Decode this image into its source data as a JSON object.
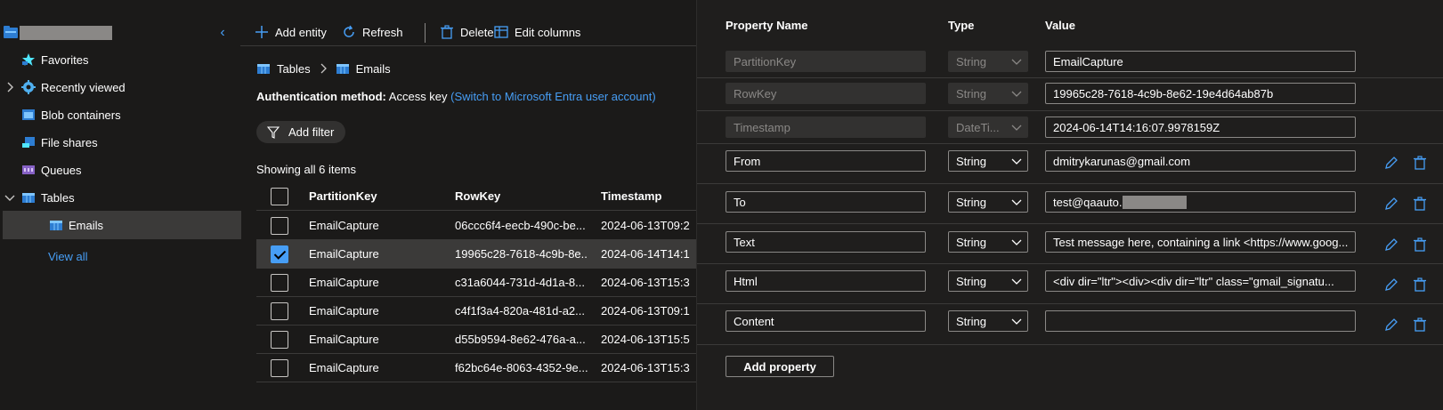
{
  "sidebar": {
    "items": [
      {
        "label": "Favorites",
        "icon": "star-icon"
      },
      {
        "label": "Recently viewed",
        "icon": "gear-icon"
      },
      {
        "label": "Blob containers",
        "icon": "blob-container-icon"
      },
      {
        "label": "File shares",
        "icon": "file-share-icon"
      },
      {
        "label": "Queues",
        "icon": "queue-icon"
      },
      {
        "label": "Tables",
        "icon": "table-icon"
      },
      {
        "label": "Emails",
        "icon": "table-icon"
      }
    ],
    "view_all": "View all"
  },
  "toolbar": {
    "add_entity": "Add entity",
    "refresh": "Refresh",
    "delete": "Delete",
    "edit_columns": "Edit columns"
  },
  "breadcrumb": {
    "root": "Tables",
    "current": "Emails"
  },
  "auth": {
    "label": "Authentication method:",
    "value": "Access key",
    "link": "(Switch to Microsoft Entra user account)"
  },
  "filter": {
    "label": "Add filter"
  },
  "showing": "Showing all 6 items",
  "table": {
    "headers": [
      "PartitionKey",
      "RowKey",
      "Timestamp"
    ],
    "rows": [
      {
        "pk": "EmailCapture",
        "rk": "06ccc6f4-eecb-490c-be...",
        "ts": "2024-06-13T09:2",
        "checked": false
      },
      {
        "pk": "EmailCapture",
        "rk": "19965c28-7618-4c9b-8e...",
        "ts": "2024-06-14T14:1",
        "checked": true
      },
      {
        "pk": "EmailCapture",
        "rk": "c31a6044-731d-4d1a-8...",
        "ts": "2024-06-13T15:3",
        "checked": false
      },
      {
        "pk": "EmailCapture",
        "rk": "c4f1f3a4-820a-481d-a2...",
        "ts": "2024-06-13T09:1",
        "checked": false
      },
      {
        "pk": "EmailCapture",
        "rk": "d55b9594-8e62-476a-a...",
        "ts": "2024-06-13T15:5",
        "checked": false
      },
      {
        "pk": "EmailCapture",
        "rk": "f62bc64e-8063-4352-9e...",
        "ts": "2024-06-13T15:3",
        "checked": false
      }
    ]
  },
  "panel": {
    "headers": {
      "name": "Property Name",
      "type": "Type",
      "value": "Value"
    },
    "properties": [
      {
        "name": "PartitionKey",
        "type": "String",
        "value": "EmailCapture",
        "locked": true
      },
      {
        "name": "RowKey",
        "type": "String",
        "value": "19965c28-7618-4c9b-8e62-19e4d64ab87b",
        "locked": true
      },
      {
        "name": "Timestamp",
        "type": "DateTi...",
        "value": "2024-06-14T14:16:07.9978159Z",
        "locked": true
      },
      {
        "name": "From",
        "type": "String",
        "value": "dmitrykarunas@gmail.com",
        "locked": false
      },
      {
        "name": "To",
        "type": "String",
        "value": "test@qaauto.",
        "locked": false
      },
      {
        "name": "Text",
        "type": "String",
        "value": "Test message here, containing a link <https://www.goog...",
        "locked": false
      },
      {
        "name": "Html",
        "type": "String",
        "value": "<div dir=\"ltr\"><div><div dir=\"ltr\" class=\"gmail_signatu...",
        "locked": false
      },
      {
        "name": "Content",
        "type": "String",
        "value": "",
        "locked": false
      }
    ],
    "add_property": "Add property"
  },
  "colors": {
    "accent": "#479ef5",
    "bg": "#1b1a19",
    "panel_bg": "#1f1e1d",
    "selected": "#3b3a39"
  }
}
